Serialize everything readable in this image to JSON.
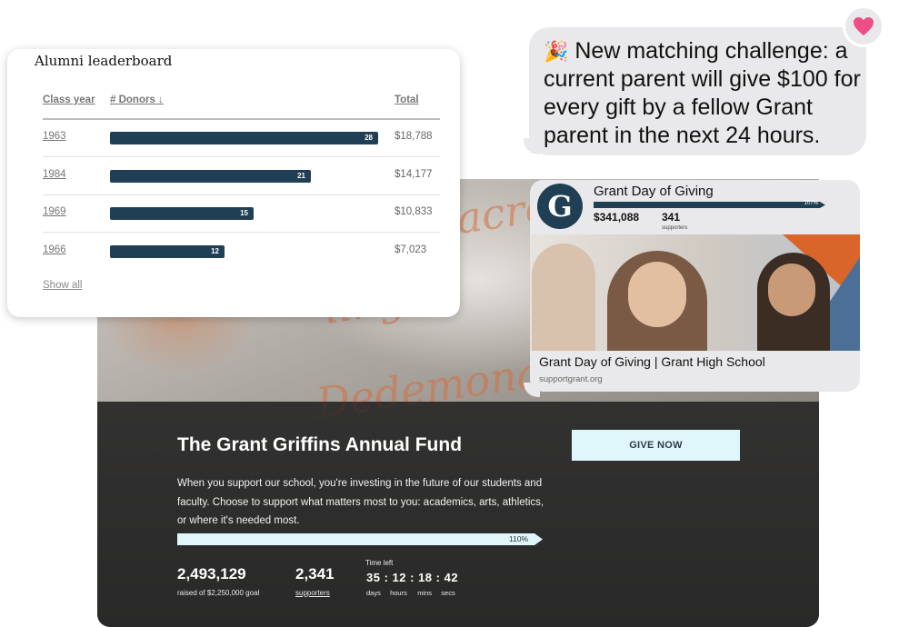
{
  "leaderboard": {
    "title": "Alumni leaderboard",
    "columns": {
      "year": "Class year",
      "donors": "# Donors ↓",
      "total": "Total"
    },
    "rows": [
      {
        "year": "1963",
        "donors": 28,
        "donors_label": "28",
        "total": "$18,788"
      },
      {
        "year": "1984",
        "donors": 21,
        "donors_label": "21",
        "total": "$14,177"
      },
      {
        "year": "1969",
        "donors": 15,
        "donors_label": "15",
        "total": "$10,833"
      },
      {
        "year": "1966",
        "donors": 12,
        "donors_label": "12",
        "total": "$7,023"
      }
    ],
    "show_all": "Show all",
    "bar_color": "#203f54"
  },
  "message": {
    "emoji": "🎉",
    "text": "New matching challenge: a current parent will give $100 for every gift by a fellow Grant parent in the next 24 hours.",
    "reaction_icon": "heart-icon",
    "reaction_color": "#ee4d86"
  },
  "preview": {
    "logo_letter": "G",
    "title": "Grant Day of Giving",
    "progress_percent": 107,
    "progress_label": "107%",
    "raised": "$341,088",
    "supporters": "341",
    "supporters_label": "supporters",
    "caption": "Grant Day of Giving | Grant High School",
    "url": "supportgrant.org"
  },
  "campaign": {
    "title": "The Grant Griffins Annual Fund",
    "description": "When you support our school, you're investing in the future of our students and faculty. Choose to support what matters most to you: academics, arts, athletics, or where it's needed most.",
    "give_button": "GIVE NOW",
    "progress_percent": 110,
    "progress_label": "110%",
    "raised": "2,493,129",
    "raised_label": "raised of $2,250,000 goal",
    "supporters": "2,341",
    "supporters_label": "supporters",
    "time_left_label": "Time left",
    "timer": {
      "days": "35",
      "hours": "12",
      "mins": "18",
      "secs": "42"
    },
    "timer_units": {
      "days": "days",
      "hours": "hours",
      "mins": "mins",
      "secs": "secs"
    },
    "accent_color": "#dff7fb"
  }
}
